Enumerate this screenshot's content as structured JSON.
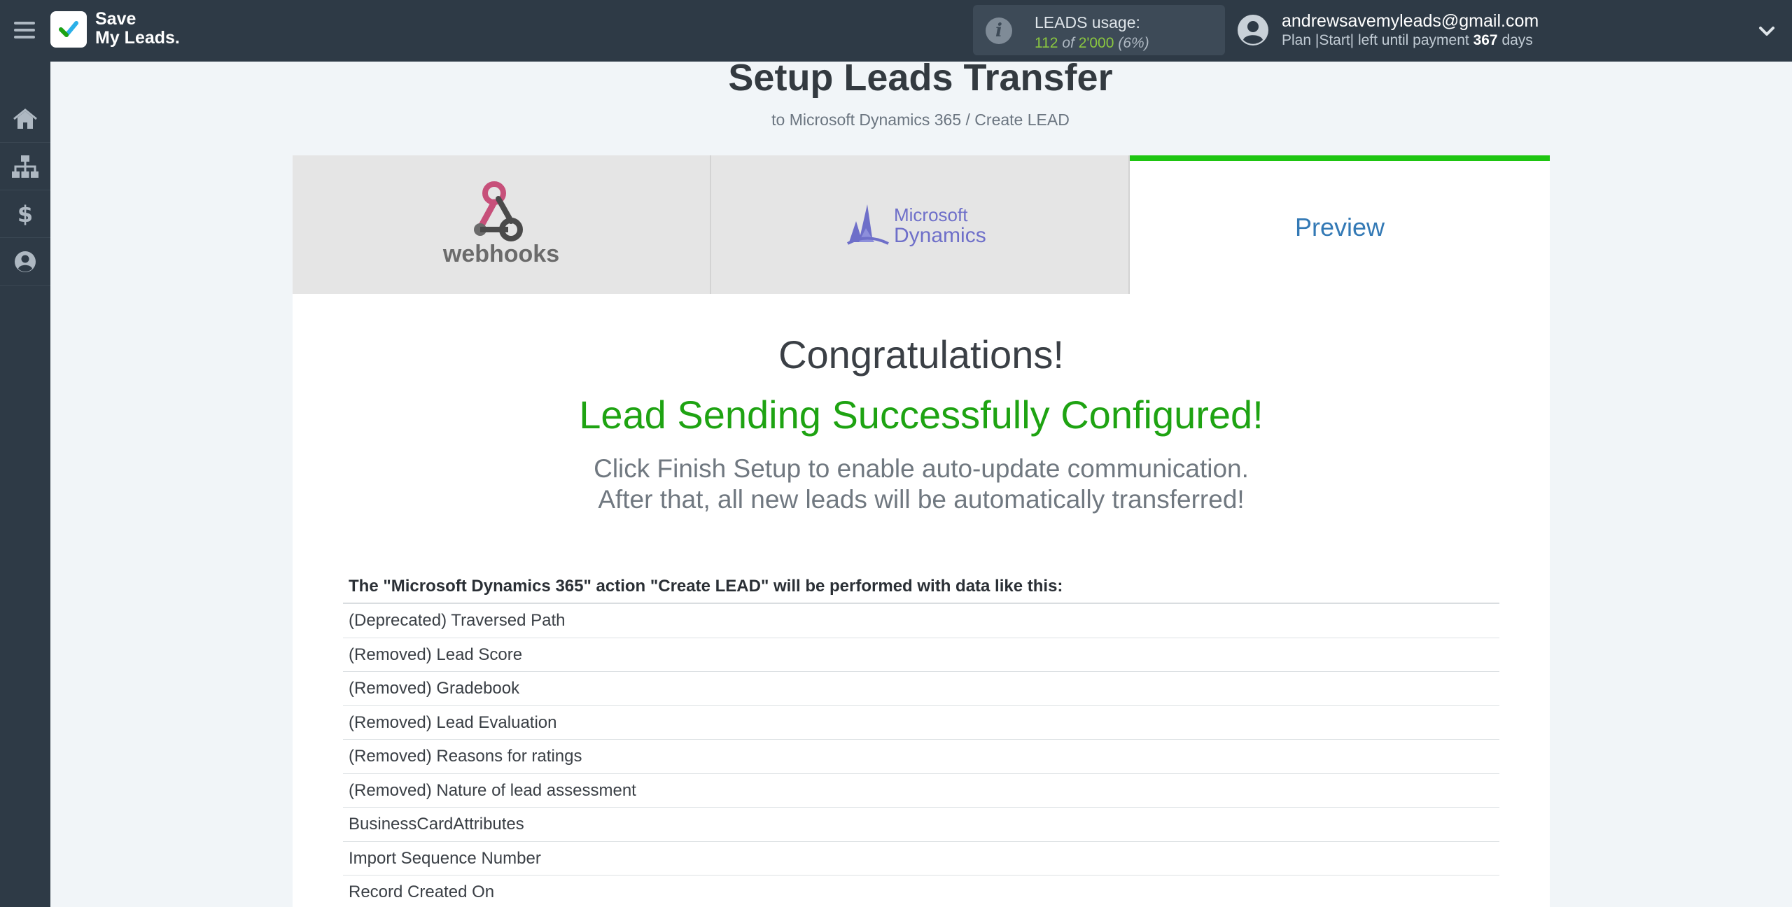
{
  "app": {
    "logo_line1": "Save",
    "logo_line2": "My Leads."
  },
  "usage": {
    "label": "LEADS usage:",
    "used": "112",
    "of_word": "of",
    "total": "2'000",
    "percent": "(6%)"
  },
  "user": {
    "email": "andrewsavemyleads@gmail.com",
    "plan_prefix": "Plan |Start| left until payment",
    "days_left": "367",
    "days_suffix": "days"
  },
  "sidebar": {
    "items": [
      {
        "icon": "home-icon"
      },
      {
        "icon": "sitemap-icon"
      },
      {
        "icon": "dollar-icon"
      },
      {
        "icon": "user-icon"
      }
    ]
  },
  "page": {
    "title": "Setup Leads Transfer",
    "subtitle": "to Microsoft Dynamics 365 / Create LEAD"
  },
  "steps": {
    "source_logo_text": "webhooks",
    "destination_logo_line1": "Microsoft",
    "destination_logo_line2": "Dynamics",
    "preview_label": "Preview"
  },
  "result": {
    "congrats": "Congratulations!",
    "success": "Lead Sending Successfully Configured!",
    "hint_line1": "Click Finish Setup to enable auto-update communication.",
    "hint_line2": "After that, all new leads will be automatically transferred!"
  },
  "table": {
    "title": "The \"Microsoft Dynamics 365\" action \"Create LEAD\" will be performed with data like this:",
    "rows": [
      "(Deprecated) Traversed Path",
      "(Removed) Lead Score",
      "(Removed) Gradebook",
      "(Removed) Lead Evaluation",
      "(Removed) Reasons for ratings",
      "(Removed) Nature of lead assessment",
      "BusinessCardAttributes",
      "Import Sequence Number",
      "Record Created On"
    ]
  },
  "colors": {
    "topbar": "#2e3a46",
    "success_green": "#1ea312",
    "active_step_bar": "#1ec511",
    "preview_blue": "#3379b5"
  }
}
